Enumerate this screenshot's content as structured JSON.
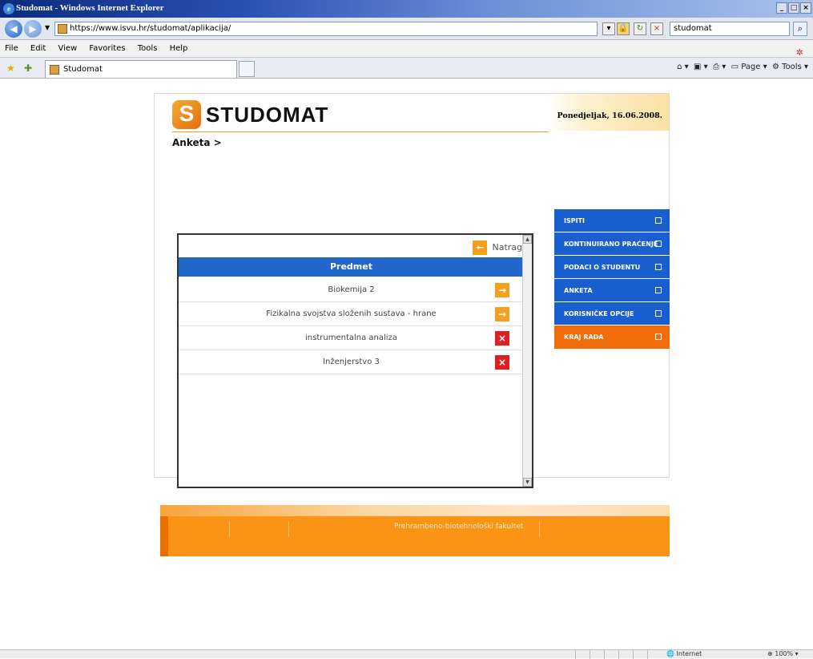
{
  "browser": {
    "window_title": "Studomat - Windows Internet Explorer",
    "url": "https://www.isvu.hr/studomat/aplikacija/",
    "search_value": "studomat",
    "menus": [
      "File",
      "Edit",
      "View",
      "Favorites",
      "Tools",
      "Help"
    ],
    "tab_title": "Studomat",
    "command_page": "Page",
    "command_tools": "Tools",
    "zone": "Internet",
    "zoom": "100%"
  },
  "app": {
    "logo_text": "STUDOMAT",
    "date": "Ponedjeljak, 16.06.2008.",
    "breadcrumb": "Anketa >",
    "back_label": "Natrag",
    "table_header": "Predmet",
    "rows": [
      {
        "name": "Biokemija 2",
        "action": "go"
      },
      {
        "name": "Fizikalna svojstva složenih sustava - hrane",
        "action": "go"
      },
      {
        "name": "instrumentalna analiza",
        "action": "no"
      },
      {
        "name": "Inženjerstvo 3",
        "action": "no"
      }
    ],
    "sidebar": [
      "ISPITI",
      "KONTINUIRANO PRAĆENJE",
      "PODACI O STUDENTU",
      "ANKETA",
      "KORISNIČKE OPCIJE",
      "KRAJ RADA"
    ],
    "footer_text": "Prehrambeno-biotehnološki fakultet"
  },
  "colors": {
    "accent_blue": "#1a5fcf",
    "accent_orange": "#fb9414",
    "danger_red": "#e02020"
  },
  "icons": {
    "back": "arrow-left-icon",
    "go": "arrow-right-icon",
    "no": "close-icon",
    "side": "square-icon"
  }
}
